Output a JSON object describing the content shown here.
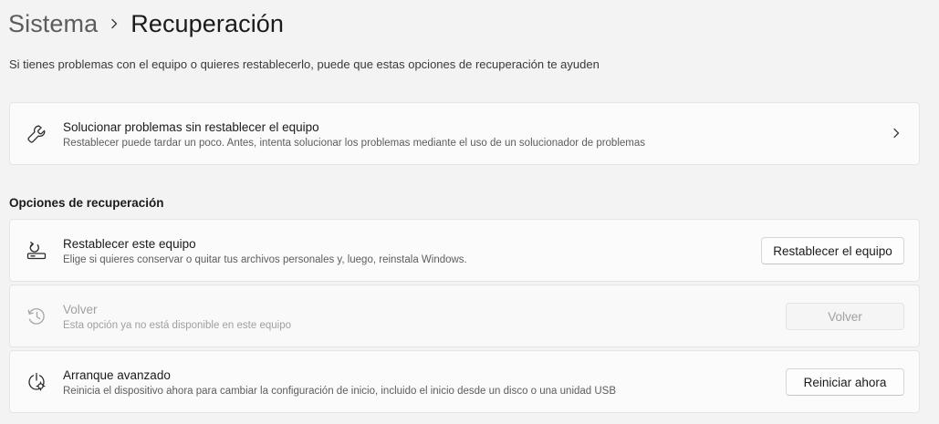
{
  "breadcrumb": {
    "parent": "Sistema",
    "current": "Recuperación"
  },
  "subtitle": "Si tienes problemas con el equipo o quieres restablecerlo, puede que estas opciones de recuperación te ayuden",
  "troubleshoot": {
    "title": "Solucionar problemas sin restablecer el equipo",
    "description": "Restablecer puede tardar un poco. Antes, intenta solucionar los problemas mediante el uso de un solucionador de problemas",
    "icon": "wrench-icon"
  },
  "recovery_section": {
    "heading": "Opciones de recuperación",
    "items": [
      {
        "title": "Restablecer este equipo",
        "description": "Elige si quieres conservar o quitar tus archivos personales y, luego, reinstala Windows.",
        "button": "Restablecer el equipo",
        "icon": "reset-pc-icon",
        "enabled": true
      },
      {
        "title": "Volver",
        "description": "Esta opción ya no está disponible en este equipo",
        "button": "Volver",
        "icon": "history-icon",
        "enabled": false
      },
      {
        "title": "Arranque avanzado",
        "description": "Reinicia el dispositivo ahora para cambiar la configuración de inicio, incluido el inicio desde un disco o una unidad USB",
        "button": "Reiniciar ahora",
        "icon": "advanced-startup-icon",
        "enabled": true
      }
    ]
  },
  "colors": {
    "background": "#f3f3f3",
    "card": "#fbfbfb",
    "border": "#e5e5e5",
    "disabled_text": "#a0a0a0"
  }
}
